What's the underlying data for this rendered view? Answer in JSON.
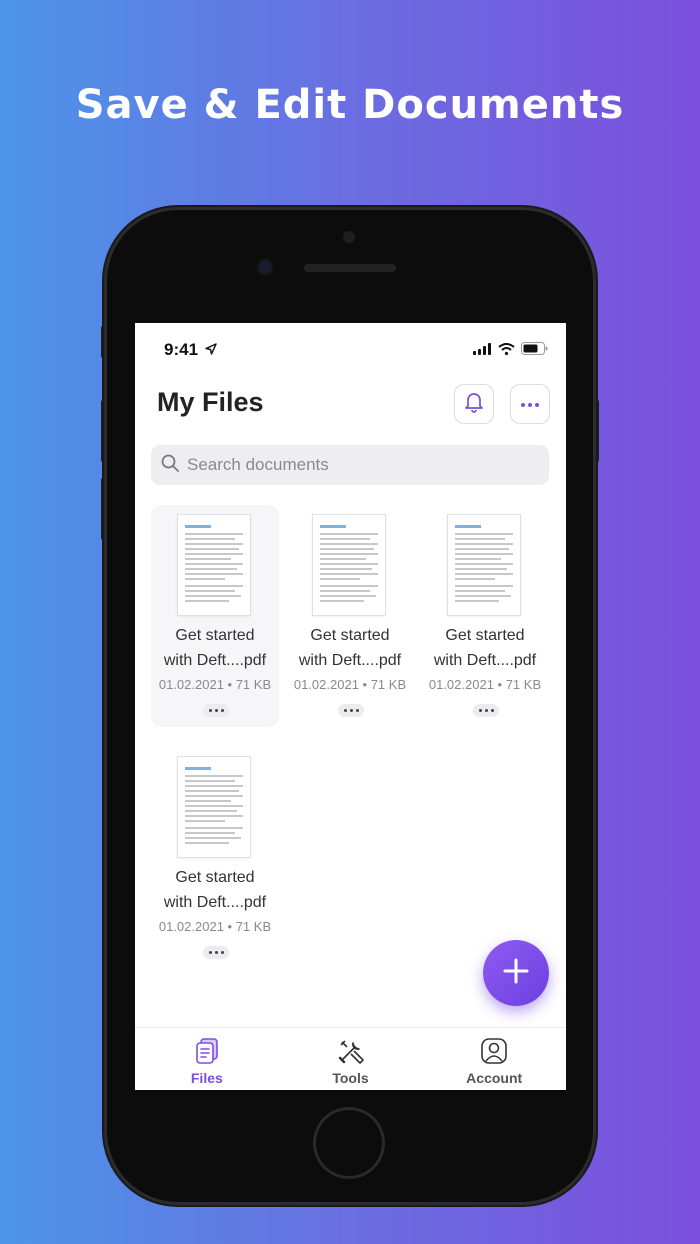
{
  "headline": "Save & Edit Documents",
  "status_bar": {
    "time": "9:41"
  },
  "header": {
    "title": "My Files"
  },
  "search": {
    "placeholder": "Search documents"
  },
  "files": [
    {
      "name_line1": "Get started",
      "name_line2": "with Deft....pdf",
      "meta": "01.02.2021 • 71 KB"
    },
    {
      "name_line1": "Get started",
      "name_line2": "with Deft....pdf",
      "meta": "01.02.2021 • 71 KB"
    },
    {
      "name_line1": "Get started",
      "name_line2": "with Deft....pdf",
      "meta": "01.02.2021 • 71 KB"
    },
    {
      "name_line1": "Get started",
      "name_line2": "with Deft....pdf",
      "meta": "01.02.2021 • 71 KB"
    }
  ],
  "tabbar": {
    "tabs": [
      {
        "label": "Files",
        "icon": "files-icon",
        "active": true
      },
      {
        "label": "Tools",
        "icon": "tools-icon",
        "active": false
      },
      {
        "label": "Account",
        "icon": "account-icon",
        "active": false
      }
    ]
  },
  "colors": {
    "accent": "#7b4fe0",
    "background_start": "#4c95e8",
    "background_end": "#7b4fdc"
  }
}
